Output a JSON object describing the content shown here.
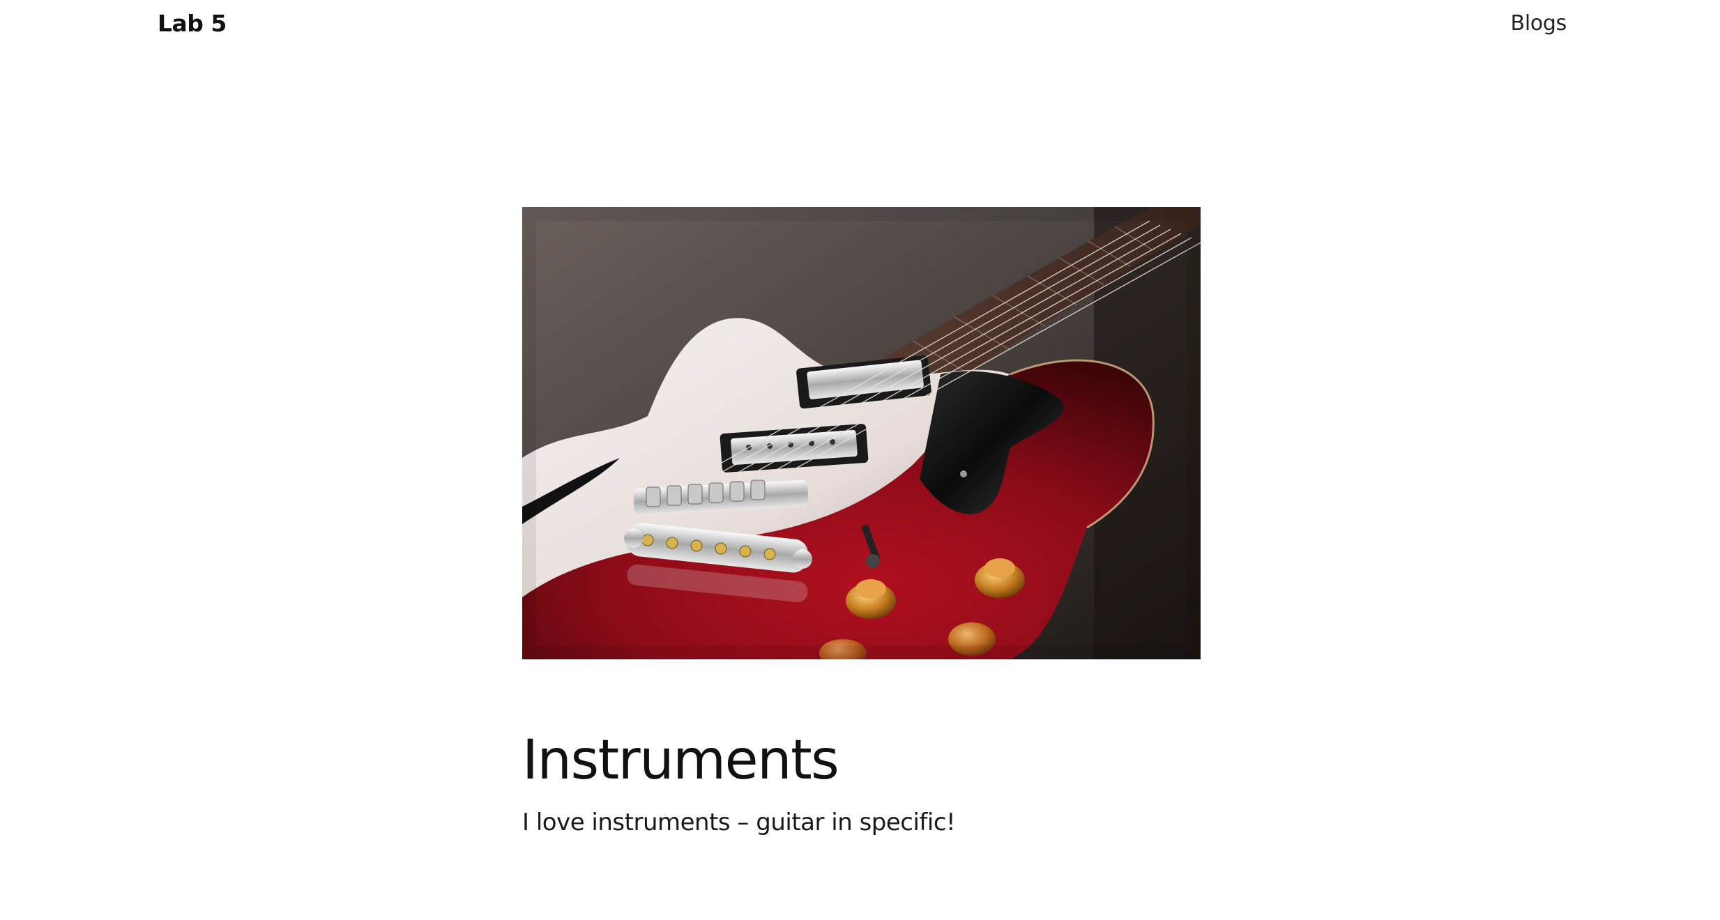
{
  "header": {
    "brand": "Lab 5",
    "nav": [
      {
        "label": "Blogs"
      }
    ]
  },
  "post": {
    "image_alt": "Red semi-hollow electric guitar",
    "title": "Instruments",
    "description": "I love instruments – guitar in specific!"
  },
  "colors": {
    "background": "#ffffff",
    "text": "#111111",
    "guitar_red": "#8e0c18"
  }
}
